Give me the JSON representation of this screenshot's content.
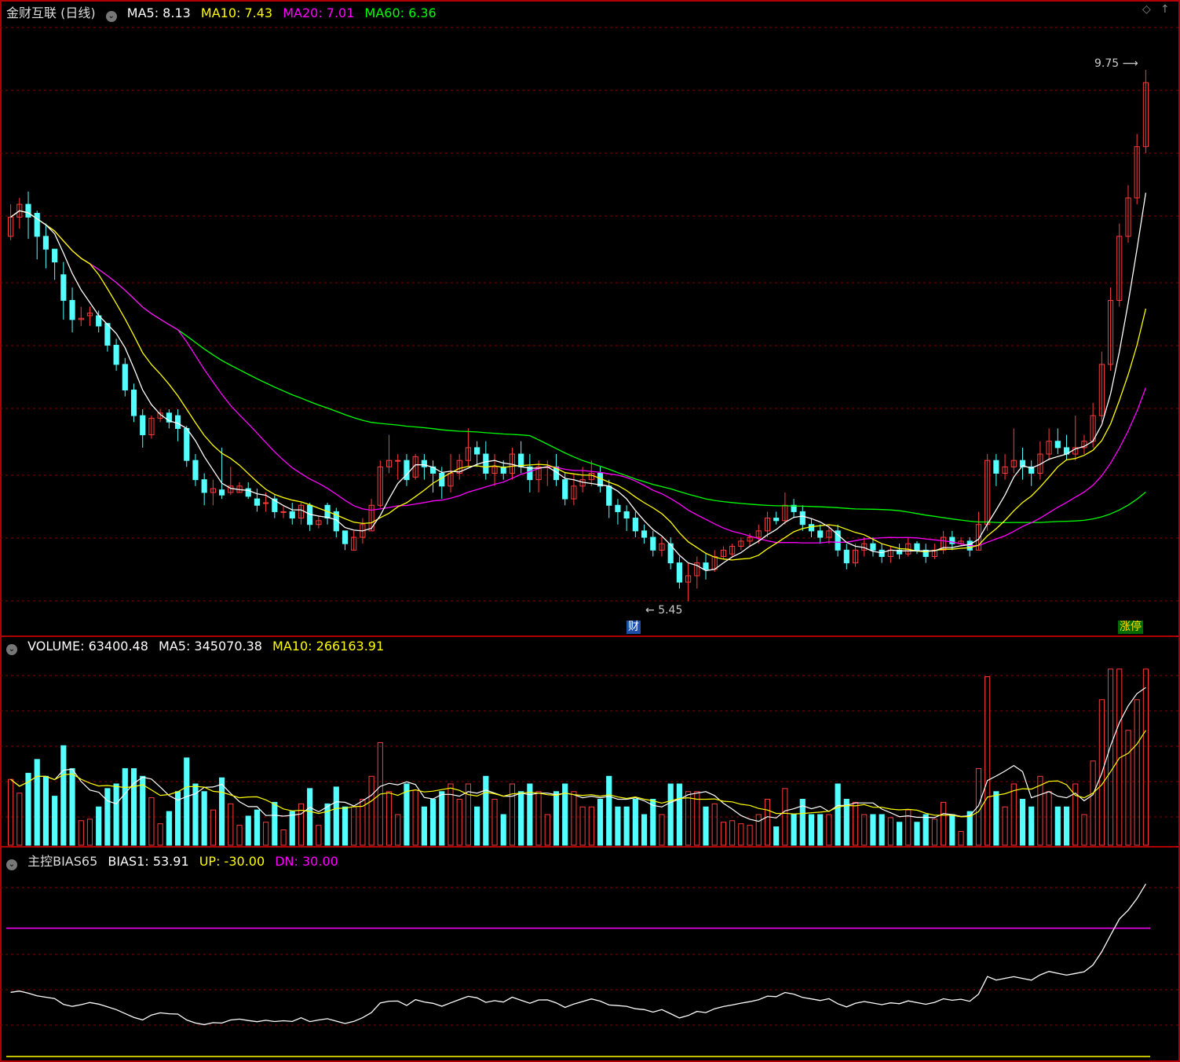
{
  "main_panel": {
    "title": "金财互联 (日线)",
    "ma5": "MA5: 8.13",
    "ma10": "MA10: 7.43",
    "ma20": "MA20: 7.01",
    "ma60": "MA60: 6.36",
    "high_label": "9.75",
    "low_label": "5.45",
    "tag_finance": "财",
    "tag_limit_up": "涨停"
  },
  "volume_panel": {
    "volume": "VOLUME: 63400.48",
    "ma5": "MA5: 345070.38",
    "ma10": "MA10: 266163.91"
  },
  "bias_panel": {
    "title": "主控BIAS65",
    "bias1": "BIAS1: 53.91",
    "up": "UP: -30.00",
    "dn": "DN: 30.00"
  },
  "icons": {
    "settings_toggle": "circle-chevron-icon",
    "window_diamond": "diamond-icon",
    "window_arrow": "up-arrow-icon"
  },
  "colors": {
    "up_candle": "#ff3b3b",
    "down_candle": "#54ffff",
    "ma5": "#ffffff",
    "ma10": "#ffff00",
    "ma20": "#ff00ff",
    "ma60": "#00ff00",
    "grid": "#8b0000",
    "border": "#b00000",
    "bias_line": "#ffffff",
    "bias_dn_line": "#ff00ff"
  },
  "chart_data": {
    "type": "candlestick",
    "price_high": 9.75,
    "price_low": 5.45,
    "candles": [
      [
        8.3,
        8.45,
        8.55,
        8.27
      ],
      [
        8.45,
        8.55,
        8.6,
        8.36
      ],
      [
        8.55,
        8.45,
        8.65,
        8.28
      ],
      [
        8.48,
        8.3,
        8.5,
        8.12
      ],
      [
        8.3,
        8.2,
        8.4,
        8.05
      ],
      [
        8.2,
        8.1,
        8.18,
        7.96
      ],
      [
        8.0,
        7.8,
        8.1,
        7.65
      ],
      [
        7.8,
        7.65,
        7.9,
        7.55
      ],
      [
        7.65,
        7.66,
        7.75,
        7.6
      ],
      [
        7.68,
        7.7,
        7.75,
        7.6
      ],
      [
        7.68,
        7.6,
        7.72,
        7.55
      ],
      [
        7.62,
        7.45,
        7.6,
        7.4
      ],
      [
        7.45,
        7.3,
        7.5,
        7.25
      ],
      [
        7.3,
        7.1,
        7.35,
        7.05
      ],
      [
        7.1,
        6.9,
        7.15,
        6.85
      ],
      [
        6.9,
        6.75,
        6.95,
        6.65
      ],
      [
        6.75,
        6.88,
        6.9,
        6.72
      ],
      [
        6.88,
        6.92,
        6.95,
        6.85
      ],
      [
        6.92,
        6.85,
        6.95,
        6.8
      ],
      [
        6.9,
        6.8,
        6.95,
        6.7
      ],
      [
        6.8,
        6.55,
        6.82,
        6.5
      ],
      [
        6.55,
        6.4,
        6.6,
        6.35
      ],
      [
        6.4,
        6.3,
        6.45,
        6.2
      ],
      [
        6.3,
        6.33,
        6.4,
        6.2
      ],
      [
        6.32,
        6.28,
        6.65,
        6.25
      ],
      [
        6.3,
        6.35,
        6.5,
        6.28
      ],
      [
        6.3,
        6.35,
        6.38,
        6.3
      ],
      [
        6.33,
        6.27,
        6.38,
        6.25
      ],
      [
        6.25,
        6.2,
        6.33,
        6.15
      ],
      [
        6.22,
        6.22,
        6.3,
        6.15
      ],
      [
        6.25,
        6.15,
        6.28,
        6.1
      ],
      [
        6.15,
        6.15,
        6.2,
        6.1
      ],
      [
        6.15,
        6.1,
        6.22,
        6.05
      ],
      [
        6.1,
        6.2,
        6.22,
        6.05
      ],
      [
        6.2,
        6.05,
        6.22,
        6.0
      ],
      [
        6.05,
        6.08,
        6.12,
        6.02
      ],
      [
        6.2,
        6.1,
        6.22,
        6.05
      ],
      [
        6.15,
        6.0,
        6.18,
        5.95
      ],
      [
        6.0,
        5.9,
        6.0,
        5.85
      ],
      [
        5.85,
        5.95,
        6.0,
        5.85
      ],
      [
        5.95,
        6.05,
        6.1,
        5.9
      ],
      [
        6.0,
        6.2,
        6.25,
        6.0
      ],
      [
        6.2,
        6.5,
        6.55,
        6.18
      ],
      [
        6.5,
        6.55,
        6.75,
        6.45
      ],
      [
        6.55,
        6.55,
        6.6,
        6.4
      ],
      [
        6.55,
        6.4,
        6.6,
        6.35
      ],
      [
        6.42,
        6.58,
        6.6,
        6.4
      ],
      [
        6.55,
        6.5,
        6.6,
        6.4
      ],
      [
        6.5,
        6.45,
        6.55,
        6.3
      ],
      [
        6.45,
        6.35,
        6.5,
        6.25
      ],
      [
        6.35,
        6.45,
        6.6,
        6.3
      ],
      [
        6.45,
        6.55,
        6.6,
        6.4
      ],
      [
        6.55,
        6.65,
        6.8,
        6.5
      ],
      [
        6.65,
        6.6,
        6.7,
        6.5
      ],
      [
        6.6,
        6.45,
        6.7,
        6.4
      ],
      [
        6.45,
        6.5,
        6.6,
        6.35
      ],
      [
        6.5,
        6.45,
        6.55,
        6.4
      ],
      [
        6.45,
        6.6,
        6.65,
        6.4
      ],
      [
        6.6,
        6.5,
        6.7,
        6.45
      ],
      [
        6.5,
        6.4,
        6.6,
        6.3
      ],
      [
        6.4,
        6.5,
        6.55,
        6.3
      ],
      [
        6.5,
        6.5,
        6.55,
        6.35
      ],
      [
        6.5,
        6.4,
        6.6,
        6.35
      ],
      [
        6.4,
        6.25,
        6.45,
        6.2
      ],
      [
        6.25,
        6.35,
        6.45,
        6.2
      ],
      [
        6.35,
        6.4,
        6.5,
        6.3
      ],
      [
        6.4,
        6.45,
        6.55,
        6.35
      ],
      [
        6.45,
        6.35,
        6.5,
        6.3
      ],
      [
        6.35,
        6.2,
        6.4,
        6.1
      ],
      [
        6.2,
        6.15,
        6.25,
        6.05
      ],
      [
        6.15,
        6.1,
        6.2,
        6.0
      ],
      [
        6.1,
        6.0,
        6.15,
        5.95
      ],
      [
        6.0,
        5.95,
        6.05,
        5.9
      ],
      [
        5.95,
        5.85,
        6.0,
        5.8
      ],
      [
        5.85,
        5.9,
        5.95,
        5.8
      ],
      [
        5.9,
        5.75,
        5.95,
        5.7
      ],
      [
        5.75,
        5.6,
        5.8,
        5.55
      ],
      [
        5.6,
        5.65,
        5.75,
        5.45
      ],
      [
        5.65,
        5.75,
        5.8,
        5.55
      ],
      [
        5.75,
        5.7,
        5.82,
        5.62
      ],
      [
        5.7,
        5.8,
        5.85,
        5.68
      ],
      [
        5.8,
        5.85,
        5.88,
        5.78
      ],
      [
        5.82,
        5.88,
        5.9,
        5.8
      ],
      [
        5.88,
        5.92,
        5.95,
        5.85
      ],
      [
        5.92,
        5.95,
        5.98,
        5.88
      ],
      [
        5.95,
        6.0,
        6.05,
        5.9
      ],
      [
        6.0,
        6.1,
        6.15,
        5.95
      ],
      [
        6.1,
        6.08,
        6.15,
        6.05
      ],
      [
        6.08,
        6.2,
        6.3,
        6.05
      ],
      [
        6.2,
        6.15,
        6.25,
        6.1
      ],
      [
        6.15,
        6.05,
        6.2,
        6.0
      ],
      [
        6.05,
        6.0,
        6.1,
        5.95
      ],
      [
        6.0,
        5.95,
        6.05,
        5.9
      ],
      [
        5.95,
        6.0,
        6.05,
        5.9
      ],
      [
        6.0,
        5.85,
        6.05,
        5.8
      ],
      [
        5.85,
        5.75,
        5.9,
        5.7
      ],
      [
        5.75,
        5.85,
        5.9,
        5.72
      ],
      [
        5.85,
        5.9,
        5.95,
        5.8
      ],
      [
        5.9,
        5.85,
        5.95,
        5.8
      ],
      [
        5.85,
        5.8,
        5.9,
        5.75
      ],
      [
        5.8,
        5.85,
        5.88,
        5.75
      ],
      [
        5.85,
        5.82,
        5.9,
        5.78
      ],
      [
        5.82,
        5.9,
        5.95,
        5.8
      ],
      [
        5.9,
        5.85,
        5.92,
        5.82
      ],
      [
        5.85,
        5.8,
        5.9,
        5.75
      ],
      [
        5.8,
        5.85,
        5.9,
        5.78
      ],
      [
        5.85,
        5.95,
        6.0,
        5.82
      ],
      [
        5.95,
        5.9,
        6.0,
        5.85
      ],
      [
        5.9,
        5.92,
        5.95,
        5.88
      ],
      [
        5.92,
        5.85,
        5.95,
        5.8
      ],
      [
        5.85,
        6.05,
        6.15,
        5.85
      ],
      [
        6.05,
        6.55,
        6.6,
        6.0
      ],
      [
        6.55,
        6.45,
        6.6,
        6.35
      ],
      [
        6.45,
        6.5,
        6.6,
        6.4
      ],
      [
        6.5,
        6.55,
        6.8,
        6.45
      ],
      [
        6.55,
        6.5,
        6.65,
        6.4
      ],
      [
        6.5,
        6.45,
        6.55,
        6.35
      ],
      [
        6.45,
        6.6,
        6.7,
        6.4
      ],
      [
        6.6,
        6.7,
        6.8,
        6.55
      ],
      [
        6.7,
        6.65,
        6.8,
        6.6
      ],
      [
        6.65,
        6.6,
        6.75,
        6.55
      ],
      [
        6.6,
        6.65,
        6.9,
        6.55
      ],
      [
        6.65,
        6.7,
        6.75,
        6.6
      ],
      [
        6.7,
        6.9,
        7.0,
        6.65
      ],
      [
        6.9,
        7.3,
        7.4,
        6.85
      ],
      [
        7.3,
        7.8,
        7.9,
        7.25
      ],
      [
        7.8,
        8.3,
        8.4,
        7.75
      ],
      [
        8.3,
        8.6,
        8.7,
        8.25
      ],
      [
        8.6,
        9.0,
        9.1,
        8.55
      ],
      [
        9.0,
        9.5,
        9.6,
        8.95
      ]
    ]
  }
}
